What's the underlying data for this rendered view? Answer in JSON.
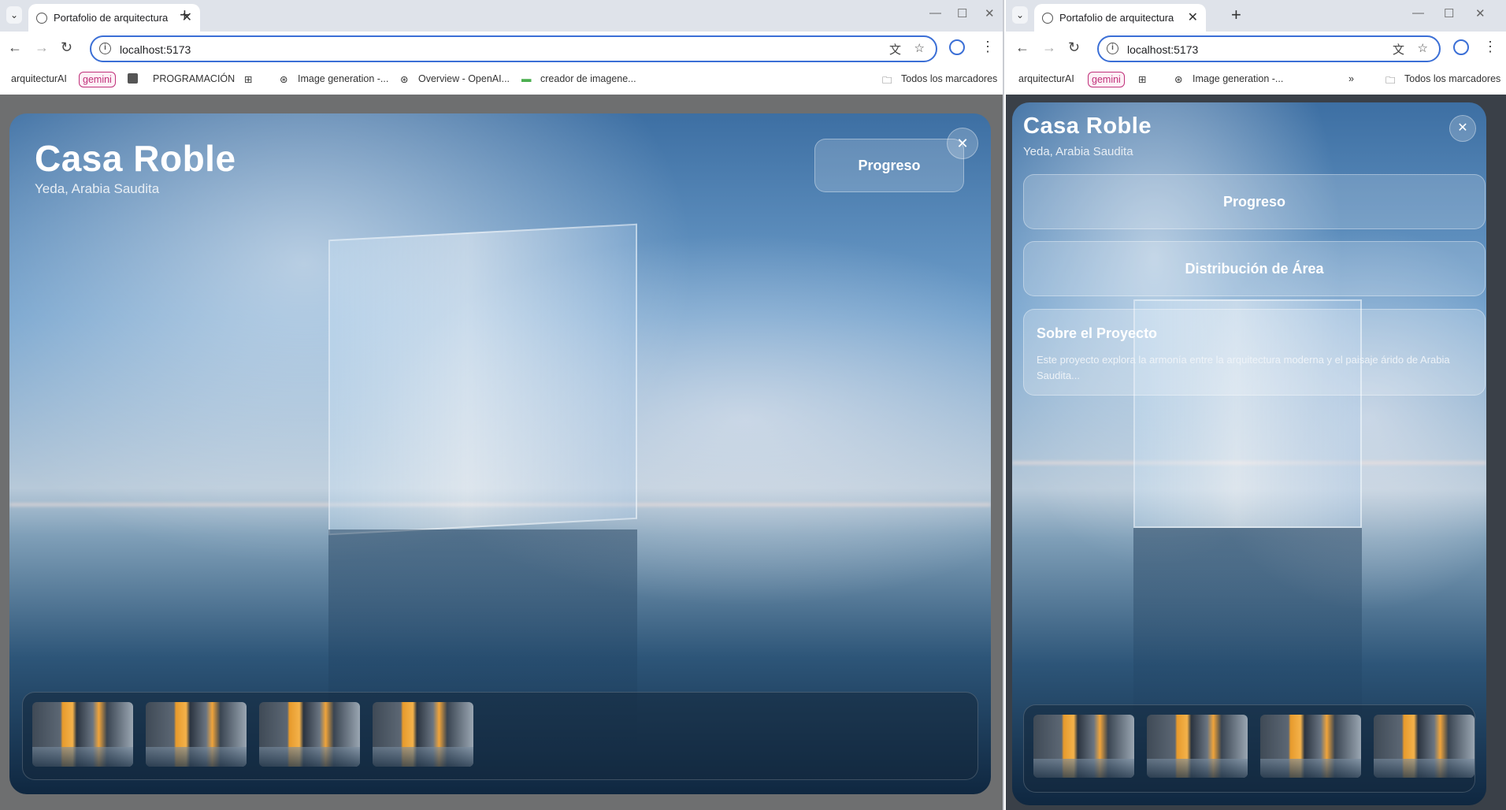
{
  "browser": {
    "tab_title": "Portafolio de arquitectura",
    "url": "localhost:5173",
    "bookmarks_left": {
      "arquitectura": "arquitecturAI",
      "gemini": "gemini",
      "programacion": "PROGRAMACIÓN",
      "image_generation": "Image generation -...",
      "overview": "Overview - OpenAI...",
      "creador": "creador de imagene...",
      "todos": "Todos los marcadores"
    },
    "bookmarks_right": {
      "arquitectura": "arquitecturAI",
      "gemini": "gemini",
      "image_generation": "Image generation -...",
      "todos": "Todos los marcadores"
    }
  },
  "project": {
    "title": "Casa Roble",
    "location": "Yeda, Arabia Saudita",
    "progress_label": "Progreso",
    "area_label": "Distribución de Área",
    "about_title": "Sobre el Proyecto",
    "about_text": "Este proyecto explora la armonía entre la arquitectura moderna y el paisaje árido de Arabia Saudita..."
  },
  "gallery": {
    "left_count": 4,
    "right_count": 4
  },
  "icons": {
    "close": "close-icon",
    "back": "back-icon",
    "forward": "forward-icon",
    "reload": "reload-icon",
    "translate": "translate-icon",
    "star": "star-icon",
    "profile": "profile-icon",
    "menu": "menu-icon"
  }
}
